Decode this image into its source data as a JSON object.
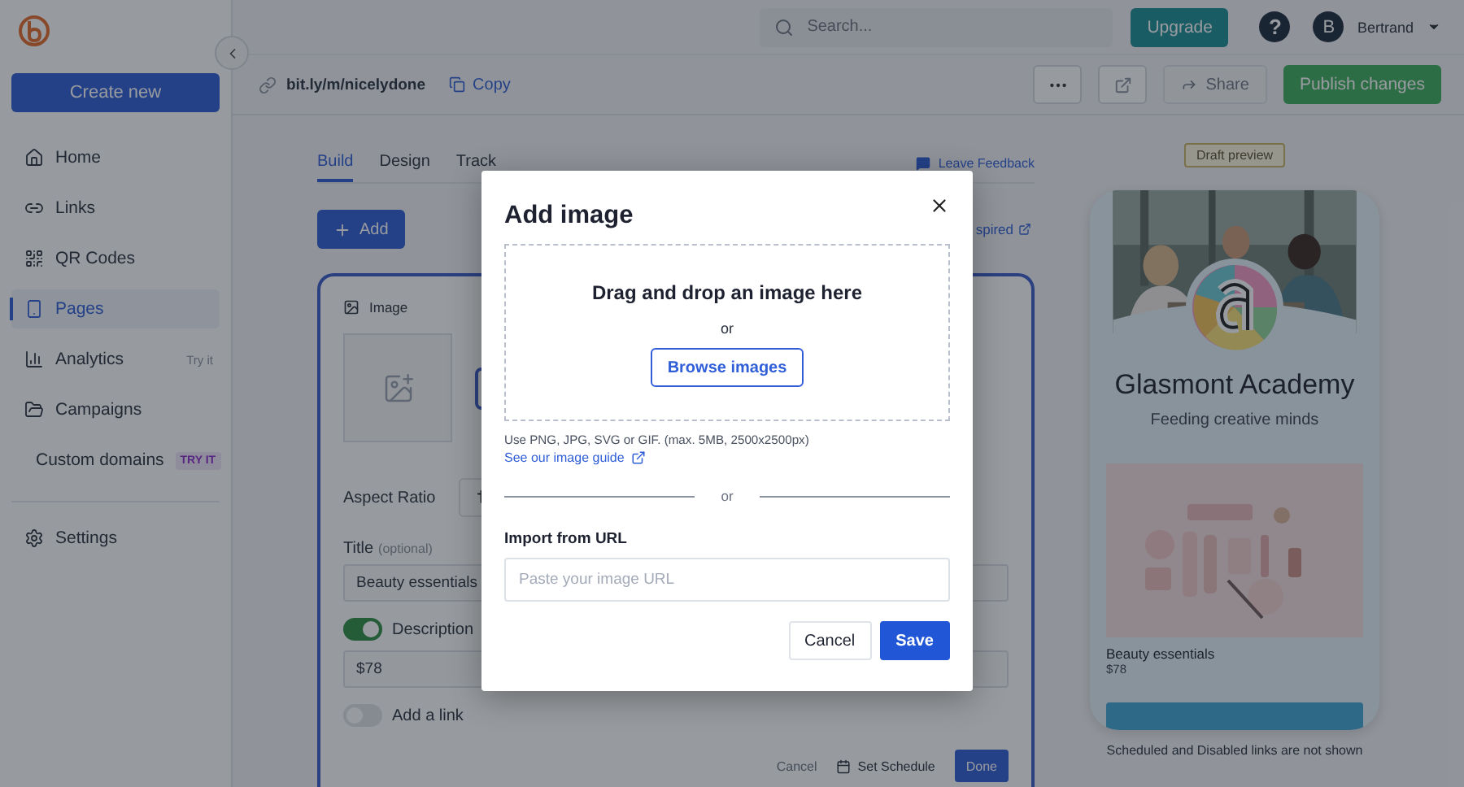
{
  "sidebar": {
    "create_button": "Create new",
    "items": [
      {
        "kind": "home",
        "label": "Home",
        "selected": false
      },
      {
        "kind": "links",
        "label": "Links",
        "selected": false
      },
      {
        "kind": "qr",
        "label": "QR Codes",
        "selected": false
      },
      {
        "kind": "pages",
        "label": "Pages",
        "selected": true
      },
      {
        "kind": "analytics",
        "label": "Analytics",
        "selected": false,
        "badge": {
          "kind": "plain",
          "text": "Try it"
        }
      },
      {
        "kind": "campaigns",
        "label": "Campaigns",
        "selected": false
      },
      {
        "kind": "domains",
        "label": "Custom domains",
        "selected": false,
        "badge": {
          "kind": "pill",
          "text": "TRY IT"
        }
      }
    ],
    "footer_items": [
      {
        "kind": "settings",
        "label": "Settings",
        "selected": false
      }
    ]
  },
  "top_bar": {
    "search": {
      "placeholder": "Search..."
    },
    "upgrade": "Upgrade",
    "help": "?",
    "user": {
      "initial": "B",
      "name": "Bertrand"
    }
  },
  "link_bar": {
    "link": "bit.ly/m/nicelydone",
    "copy": "Copy",
    "share": {
      "label": "Share",
      "disabled": true
    },
    "publish": "Publish changes"
  },
  "editor": {
    "tabs": [
      {
        "label": "Build",
        "selected": true
      },
      {
        "label": "Design",
        "selected": false
      },
      {
        "label": "Track",
        "selected": false
      }
    ],
    "feedback": "Leave Feedback",
    "add": "Add",
    "inspired": "spired",
    "card": {
      "heading": "Image",
      "aspect_label": "Aspect Ratio",
      "title_label": "Title",
      "title_hint": "(optional)",
      "title_value": "Beauty essentials",
      "toggles": [
        {
          "label": "Description",
          "on": true,
          "value": "$78"
        },
        {
          "label": "Add a link",
          "on": false
        }
      ],
      "cancel": "Cancel",
      "schedule": "Set Schedule",
      "done": "Done"
    }
  },
  "preview": {
    "badge": "Draft preview",
    "name": "Glasmont Academy",
    "tagline": "Feeding creative minds",
    "product": {
      "title": "Beauty essentials",
      "price": "$78"
    },
    "note": "Scheduled and Disabled links are not shown"
  },
  "modal": {
    "title": "Add image",
    "drop_text": "Drag and drop an image here",
    "or": "or",
    "browse": "Browse images",
    "hint": "Use PNG, JPG, SVG or GIF. (max. 5MB, 2500x2500px)",
    "guide": "See our image guide",
    "divider": "or",
    "url_label": "Import from URL",
    "url_placeholder": "Paste your image URL",
    "cancel": "Cancel",
    "save": "Save"
  }
}
